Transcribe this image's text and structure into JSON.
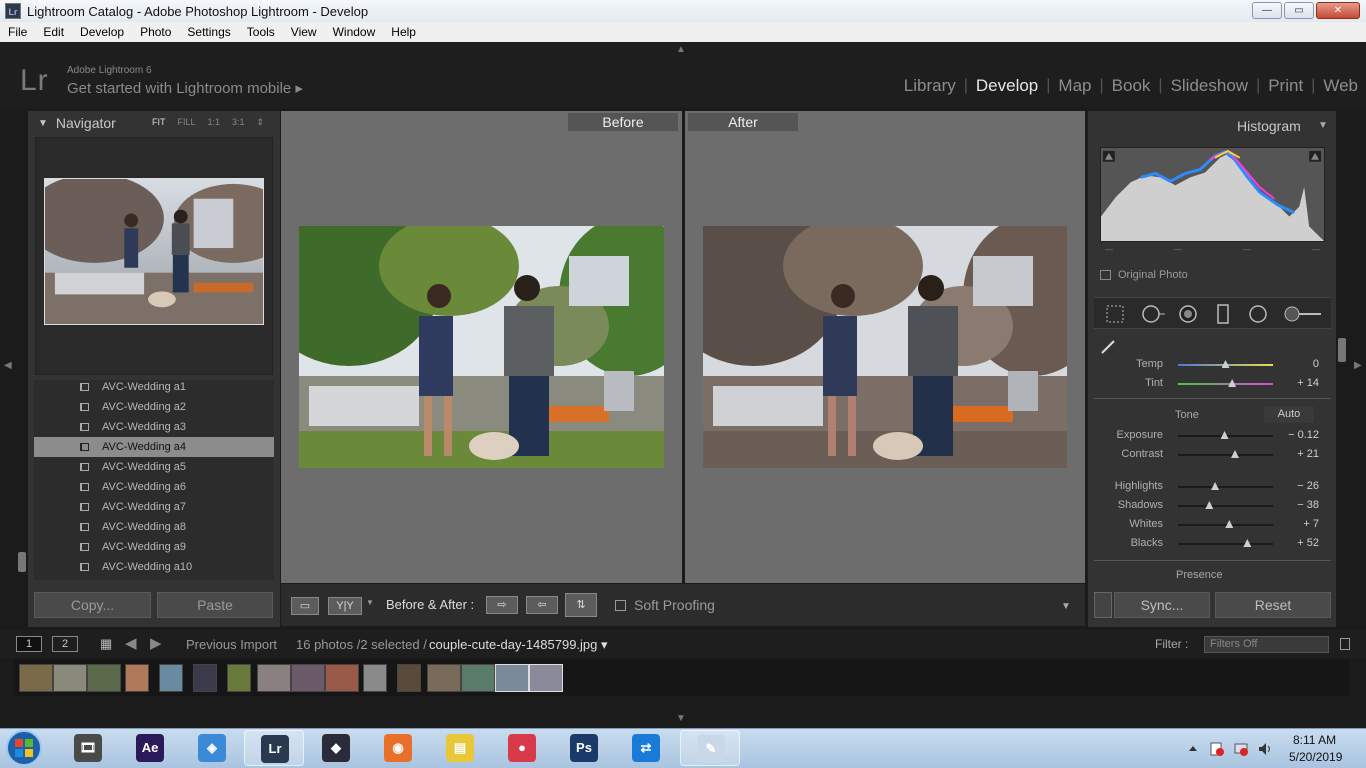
{
  "window": {
    "title": "Lightroom Catalog - Adobe Photoshop Lightroom - Develop",
    "app_icon_text": "Lr",
    "minimize": "—",
    "maximize": "▭",
    "close": "✕"
  },
  "menu": [
    "File",
    "Edit",
    "Develop",
    "Photo",
    "Settings",
    "Tools",
    "View",
    "Window",
    "Help"
  ],
  "identity": {
    "logo": "Lr",
    "line1": "Adobe Lightroom 6",
    "line2": "Get started with Lightroom mobile ▸"
  },
  "modules": [
    "Library",
    "Develop",
    "Map",
    "Book",
    "Slideshow",
    "Print",
    "Web"
  ],
  "active_module": "Develop",
  "navigator": {
    "title": "Navigator",
    "zoom": [
      "FIT",
      "FILL",
      "1:1",
      "3:1"
    ],
    "zoom_selected": "FIT"
  },
  "presets": [
    "AVC-Wedding a1",
    "AVC-Wedding a2",
    "AVC-Wedding a3",
    "AVC-Wedding a4",
    "AVC-Wedding a5",
    "AVC-Wedding a6",
    "AVC-Wedding a7",
    "AVC-Wedding a8",
    "AVC-Wedding a9",
    "AVC-Wedding a10"
  ],
  "preset_selected": "AVC-Wedding a4",
  "left_buttons": {
    "copy": "Copy...",
    "paste": "Paste"
  },
  "compare": {
    "before": "Before",
    "after": "After"
  },
  "toolbar": {
    "yy": "Y|Y",
    "before_after_label": "Before & After :",
    "soft_proofing": "Soft Proofing"
  },
  "histogram": {
    "title": "Histogram",
    "original_photo": "Original Photo"
  },
  "basic": {
    "temp": {
      "label": "Temp",
      "value": "0",
      "pos": 0.5
    },
    "tint": {
      "label": "Tint",
      "value": "+ 14",
      "pos": 0.57
    },
    "tone_label": "Tone",
    "auto": "Auto",
    "exposure": {
      "label": "Exposure",
      "value": "− 0.12",
      "pos": 0.49
    },
    "contrast": {
      "label": "Contrast",
      "value": "+ 21",
      "pos": 0.6
    },
    "highlights": {
      "label": "Highlights",
      "value": "− 26",
      "pos": 0.39
    },
    "shadows": {
      "label": "Shadows",
      "value": "− 38",
      "pos": 0.33
    },
    "whites": {
      "label": "Whites",
      "value": "+ 7",
      "pos": 0.54
    },
    "blacks": {
      "label": "Blacks",
      "value": "+ 52",
      "pos": 0.73
    },
    "presence_label": "Presence"
  },
  "right_buttons": {
    "sync": "Sync...",
    "reset": "Reset"
  },
  "filmstrip": {
    "page1": "1",
    "page2": "2",
    "source": "Previous Import",
    "count": "16 photos /2 selected /",
    "filename": "couple-cute-day-1485799.jpg ▾",
    "filter_label": "Filter :",
    "filter_value": "Filters Off",
    "thumb_count": 16,
    "selected_thumbs": [
      15,
      16
    ]
  },
  "taskbar": {
    "time": "8:11 AM",
    "date": "5/20/2019",
    "apps": [
      "movie-maker",
      "after-effects",
      "app-diamond",
      "lightroom",
      "filmora",
      "firefox",
      "file-explorer",
      "screen-recorder",
      "photoshop",
      "teamviewer",
      "paint"
    ]
  }
}
